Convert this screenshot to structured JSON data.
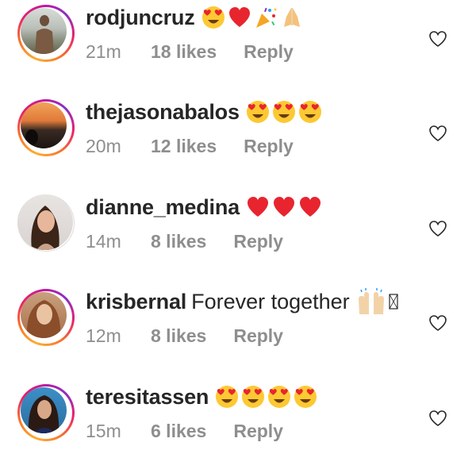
{
  "comments": [
    {
      "username": "rodjuncruz",
      "text": "",
      "emojis": [
        "heart-eyes",
        "red-heart",
        "party-popper",
        "folded-hands"
      ],
      "time": "21m",
      "likes": "18 likes",
      "reply": "Reply",
      "story_ring": true,
      "like_icon": "heart-outline-icon"
    },
    {
      "username": "thejasonabalos",
      "text": "",
      "emojis": [
        "heart-eyes",
        "heart-eyes",
        "heart-eyes"
      ],
      "time": "20m",
      "likes": "12 likes",
      "reply": "Reply",
      "story_ring": true,
      "like_icon": "heart-outline-icon"
    },
    {
      "username": "dianne_medina",
      "text": "",
      "emojis": [
        "red-heart",
        "red-heart",
        "red-heart"
      ],
      "time": "14m",
      "likes": "8 likes",
      "reply": "Reply",
      "story_ring": false,
      "like_icon": "heart-outline-icon"
    },
    {
      "username": "krisbernal",
      "text": "Forever together",
      "emojis": [
        "raising-hands",
        "missing-glyph"
      ],
      "time": "12m",
      "likes": "8 likes",
      "reply": "Reply",
      "story_ring": true,
      "like_icon": "heart-outline-icon"
    },
    {
      "username": "teresitassen",
      "text": "",
      "emojis": [
        "heart-eyes",
        "heart-eyes",
        "heart-eyes",
        "heart-eyes"
      ],
      "time": "15m",
      "likes": "6 likes",
      "reply": "Reply",
      "story_ring": true,
      "like_icon": "heart-outline-icon"
    }
  ],
  "colors": {
    "username": "#262626",
    "meta": "#8e8e8e",
    "heart_red": "#e8252f",
    "emoji_yellow": "#fcc933"
  }
}
